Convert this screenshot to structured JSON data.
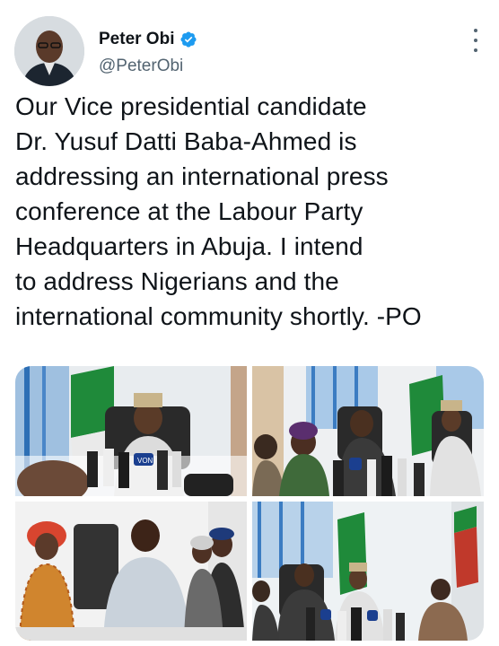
{
  "tweet": {
    "author_name": "Peter Obi",
    "author_handle": "@PeterObi",
    "verified": true,
    "text": "Our Vice presidential candidate\nDr. Yusuf Datti Baba-Ahmed is\naddressing an international press\nconference at the Labour Party\nHeadquarters in Abuja. I intend\nto address Nigerians and the\ninternational community shortly. -PO"
  },
  "media": {
    "photo_count": 4,
    "mic_label": "VON"
  },
  "colors": {
    "verified_blue": "#1d9bf0",
    "text": "#0f1419",
    "secondary": "#536471",
    "flag_green": "#1f8a3a"
  }
}
